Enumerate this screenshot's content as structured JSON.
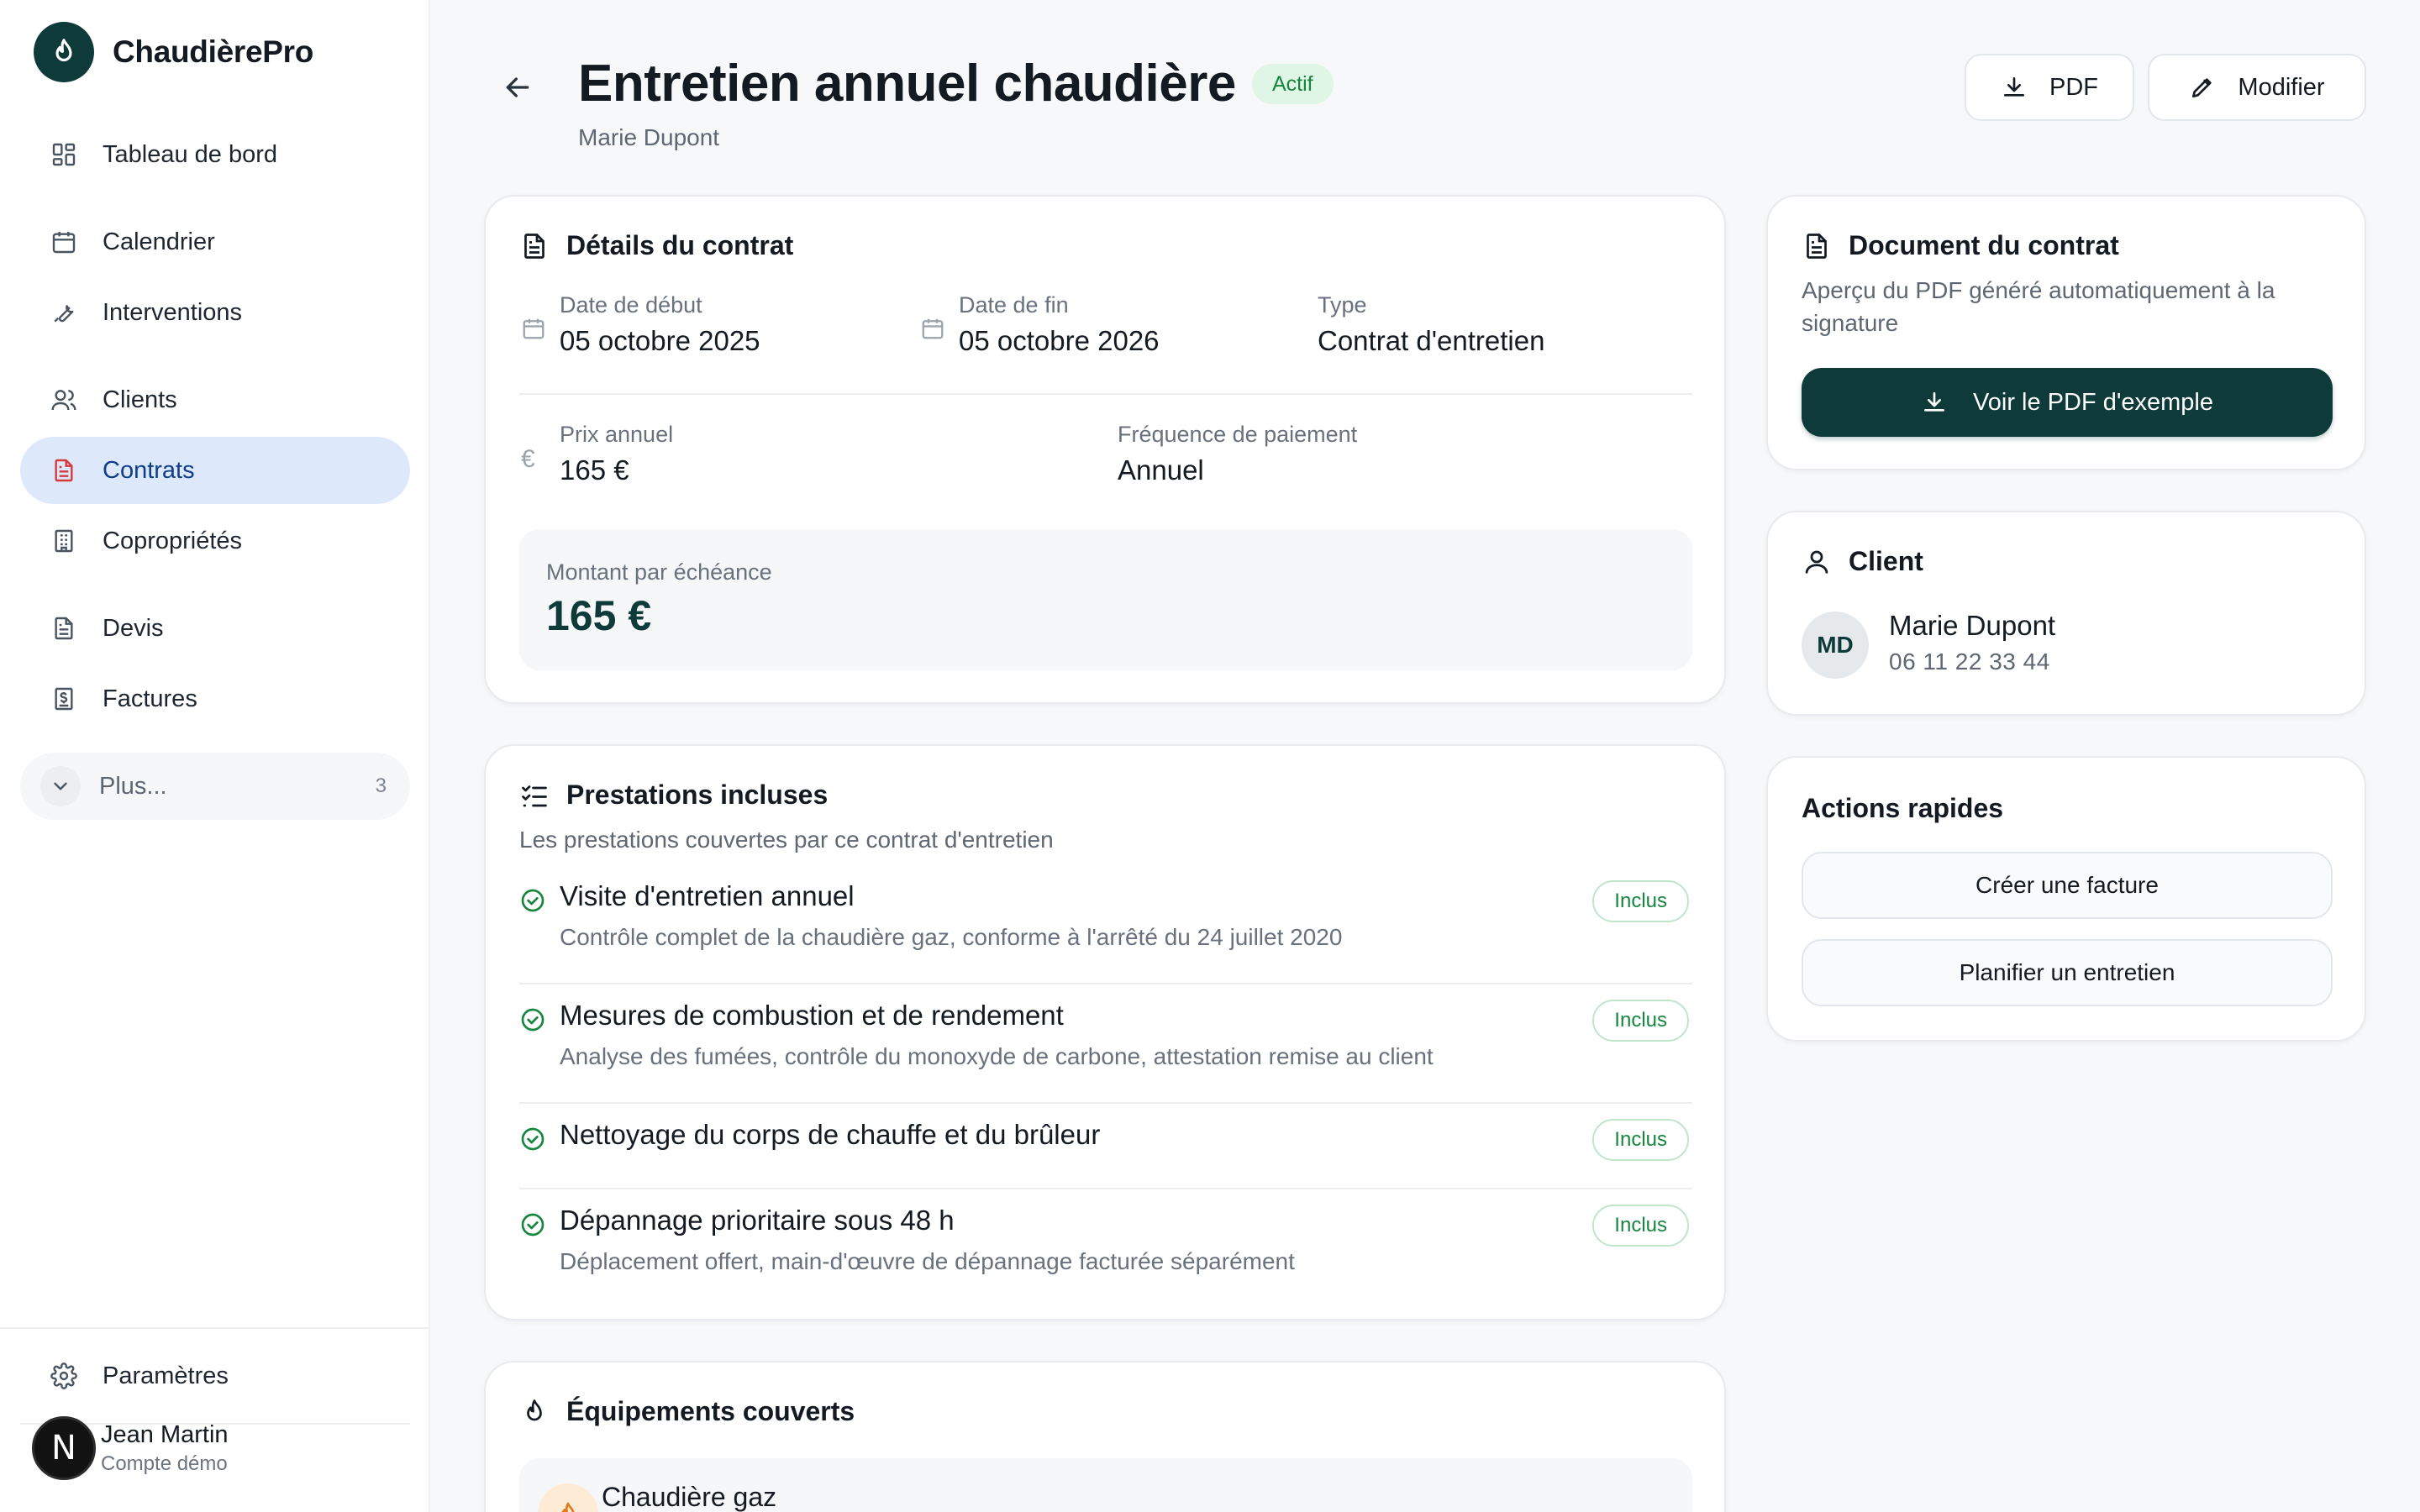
{
  "app": {
    "name": "ChaudièrePro"
  },
  "sidebar": {
    "items": [
      {
        "label": "Tableau de bord",
        "icon": "dashboard-icon"
      },
      {
        "label": "Calendrier",
        "icon": "calendar-icon"
      },
      {
        "label": "Interventions",
        "icon": "wrench-icon"
      },
      {
        "label": "Clients",
        "icon": "users-icon"
      },
      {
        "label": "Contrats",
        "icon": "document-icon",
        "active": true
      },
      {
        "label": "Copropriétés",
        "icon": "building-icon"
      },
      {
        "label": "Devis",
        "icon": "document-icon"
      },
      {
        "label": "Factures",
        "icon": "invoice-icon"
      }
    ],
    "more": {
      "label": "Plus...",
      "count": "3"
    },
    "settings": "Paramètres",
    "user": {
      "initial": "N",
      "name": "Jean Martin",
      "subtitle": "Compte démo"
    }
  },
  "header": {
    "title": "Entretien annuel chaudière",
    "status": "Actif",
    "subtitle": "Marie Dupont",
    "pdf_label": "PDF",
    "edit_label": "Modifier"
  },
  "contract": {
    "title": "Détails du contrat",
    "start_label": "Date de début",
    "start_value": "05 octobre 2025",
    "end_label": "Date de fin",
    "end_value": "05 octobre 2026",
    "type_label": "Type",
    "type_value": "Contrat d'entretien",
    "price_label": "Prix annuel",
    "price_value": "165 €",
    "frequency_label": "Fréquence de paiement",
    "frequency_value": "Annuel",
    "installment_label": "Montant par échéance",
    "installment_value": "165 €"
  },
  "services": {
    "title": "Prestations incluses",
    "subtitle": "Les prestations couvertes par ce contrat d'entretien",
    "items": [
      {
        "title": "Visite d'entretien annuel",
        "desc": "Contrôle complet de la chaudière gaz, conforme à l'arrêté du 24 juillet 2020",
        "badge": "Inclus"
      },
      {
        "title": "Mesures de combustion et de rendement",
        "desc": "Analyse des fumées, contrôle du monoxyde de carbone, attestation remise au client",
        "badge": "Inclus"
      },
      {
        "title": "Nettoyage du corps de chauffe et du brûleur",
        "desc": "",
        "badge": "Inclus"
      },
      {
        "title": "Dépannage prioritaire sous 48 h",
        "desc": "Déplacement offert, main-d'œuvre de dépannage facturée séparément",
        "badge": "Inclus"
      }
    ]
  },
  "equipment": {
    "title": "Équipements couverts",
    "items": [
      {
        "name": "Chaudière gaz"
      }
    ]
  },
  "document": {
    "title": "Document du contrat",
    "desc": "Aperçu du PDF généré automatiquement à la signature",
    "button": "Voir le PDF d'exemple"
  },
  "client": {
    "title": "Client",
    "initials": "MD",
    "name": "Marie Dupont",
    "phone": "06 11 22 33 44"
  },
  "quick_actions": {
    "title": "Actions rapides",
    "create_invoice": "Créer une facture",
    "schedule": "Planifier un entretien"
  },
  "colors": {
    "brand": "#0e3a3a",
    "active_nav_bg": "#dde9fb",
    "success": "#16863e",
    "success_bg": "#dff5e6"
  }
}
